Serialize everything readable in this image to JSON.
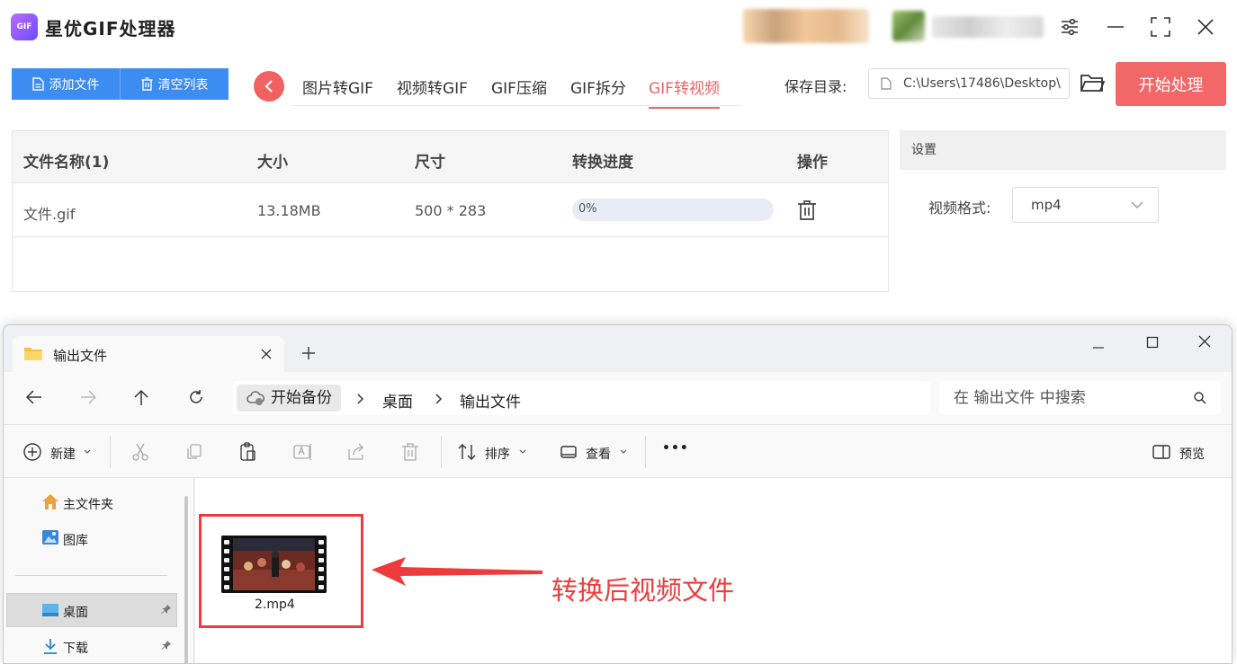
{
  "app": {
    "logo": "GIF",
    "title": "星优GIF处理器",
    "buttons": {
      "add_file": "添加文件",
      "clear_list": "清空列表",
      "start": "开始处理"
    },
    "tabs": [
      {
        "label": "图片转GIF"
      },
      {
        "label": "视频转GIF"
      },
      {
        "label": "GIF压缩"
      },
      {
        "label": "GIF拆分"
      },
      {
        "label": "GIF转视频",
        "active": true
      }
    ],
    "save_label": "保存目录:",
    "save_path": "C:\\Users\\17486\\Desktop\\",
    "table": {
      "headers": [
        "文件名称(1)",
        "大小",
        "尺寸",
        "转换进度",
        "操作"
      ],
      "rows": [
        {
          "name": "文件.gif",
          "size": "13.18MB",
          "dimensions": "500 * 283",
          "progress_text": "0%",
          "progress": 0
        }
      ]
    },
    "settings": {
      "title": "设置",
      "format_label": "视频格式:",
      "format_value": "mp4"
    },
    "colors": {
      "accent": "#f26161",
      "primary": "#3d8cf2"
    }
  },
  "explorer": {
    "tab_title": "输出文件",
    "breadcrumb": [
      "开始备份",
      "桌面",
      "输出文件"
    ],
    "search_placeholder": "在 输出文件 中搜索",
    "commands": {
      "new": "新建",
      "sort": "排序",
      "view": "查看",
      "preview": "预览",
      "more": "•••"
    },
    "sidebar": [
      {
        "label": "主文件夹",
        "icon": "home-icon"
      },
      {
        "label": "图库",
        "icon": "gallery-icon"
      },
      {
        "label": "桌面",
        "icon": "desktop-icon",
        "selected": true
      },
      {
        "label": "下载",
        "icon": "download-icon"
      }
    ],
    "file": {
      "name": "2.mp4",
      "icon": "video-file-icon"
    },
    "annotation": "转换后视频文件"
  }
}
